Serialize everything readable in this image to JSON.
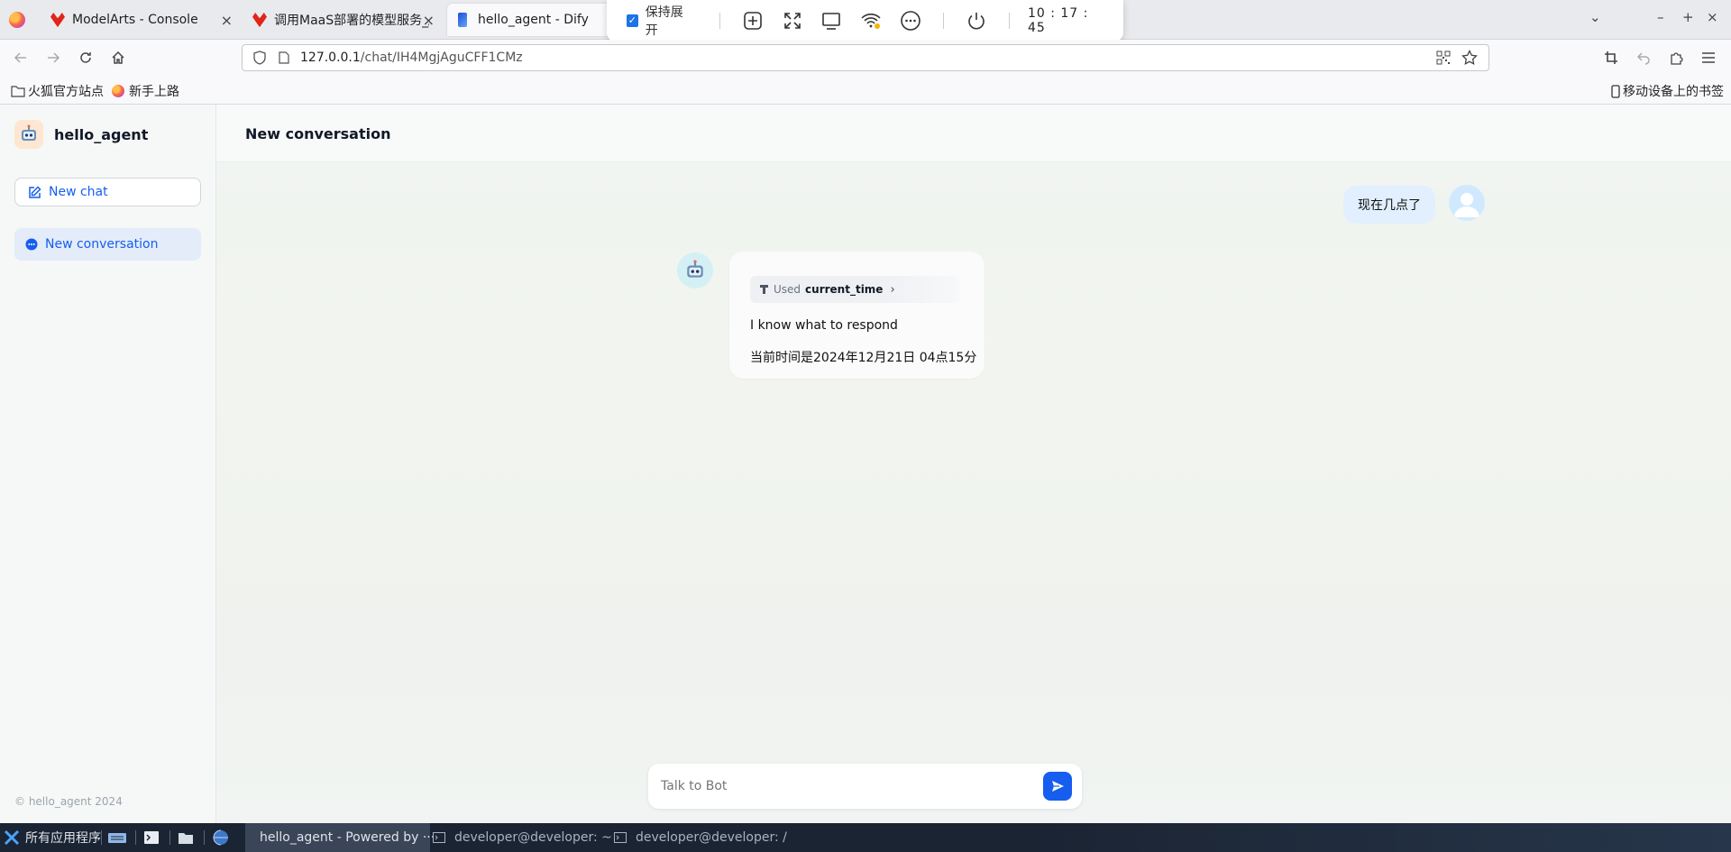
{
  "browser": {
    "tabs": [
      {
        "title": "ModelArts - Console",
        "icon": "huawei-icon"
      },
      {
        "title": "调用MaaS部署的模型服务_/",
        "icon": "huawei-icon"
      },
      {
        "title": "hello_agent - Dify",
        "icon": "dify-icon",
        "active": true
      }
    ],
    "overlay": {
      "keep_expanded_label": "保持展开",
      "clock": "10 : 17 : 45"
    },
    "url": {
      "host": "127.0.0.1",
      "path": "/chat/IH4MgjAguCFF1CMz"
    },
    "bookmarks": [
      {
        "label": "火狐官方站点",
        "icon": "folder-icon"
      },
      {
        "label": "新手上路",
        "icon": "firefox-icon"
      }
    ],
    "mobile_bookmarks_label": "移动设备上的书签"
  },
  "app": {
    "name": "hello_agent",
    "new_chat_label": "New chat",
    "conversations": [
      {
        "label": "New conversation",
        "selected": true
      }
    ],
    "copyright": "© hello_agent 2024",
    "header_title": "New conversation",
    "messages": [
      {
        "role": "user",
        "text": "现在几点了"
      },
      {
        "role": "assistant",
        "tool_used_prefix": "Used",
        "tool_name": "current_time",
        "lines": [
          "I know what to respond",
          "当前时间是2024年12月21日 04点15分"
        ]
      }
    ],
    "input_placeholder": "Talk to Bot",
    "accent_color": "#155eef"
  },
  "taskbar": {
    "start_label": "所有应用程序",
    "items": [
      {
        "label": "hello_agent - Powered by ···",
        "active": true
      },
      {
        "label": "developer@developer: ~"
      },
      {
        "label": "developer@developer: /"
      }
    ]
  }
}
